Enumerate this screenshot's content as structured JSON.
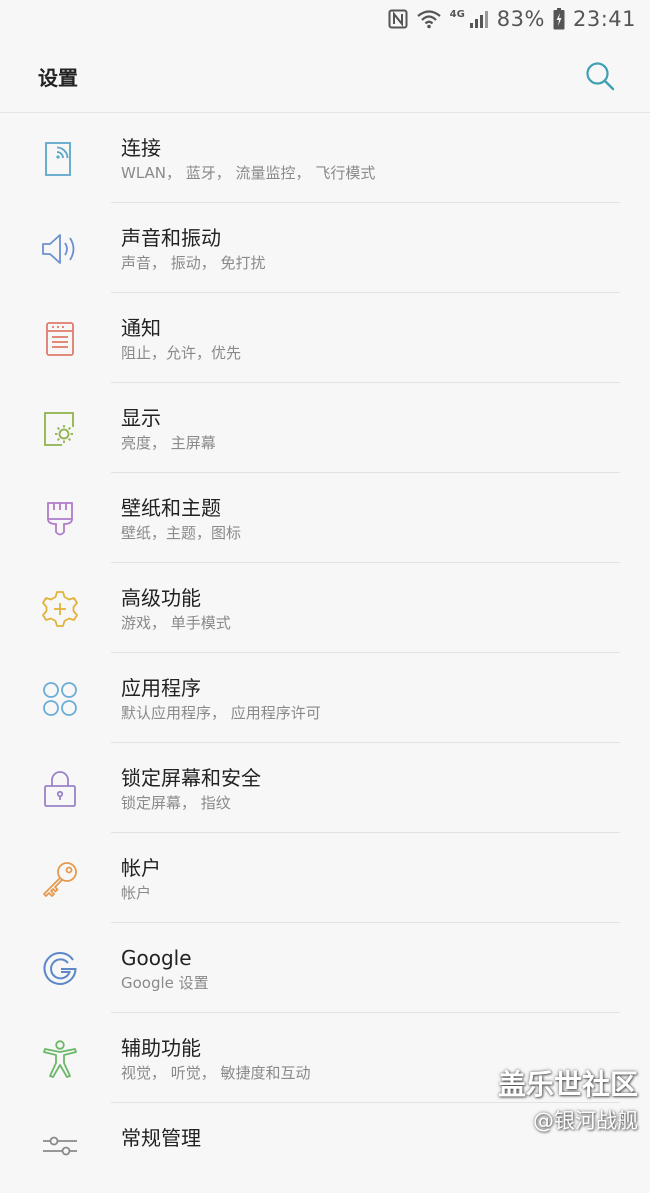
{
  "status_bar": {
    "network_type": "4G",
    "battery": "83%",
    "time": "23:41"
  },
  "header": {
    "title": "设置"
  },
  "items": [
    {
      "label": "连接",
      "sub": "WLAN， 蓝牙， 流量监控， 飞行模式",
      "icon": "connection-icon",
      "color": "#5aa5c9"
    },
    {
      "label": "声音和振动",
      "sub": "声音， 振动， 免打扰",
      "icon": "sound-icon",
      "color": "#6c8fcf"
    },
    {
      "label": "通知",
      "sub": "阻止，允许，优先",
      "icon": "notification-icon",
      "color": "#e07b6b"
    },
    {
      "label": "显示",
      "sub": "亮度， 主屏幕",
      "icon": "display-icon",
      "color": "#8fb24a"
    },
    {
      "label": "壁纸和主题",
      "sub": "壁纸，主题，图标",
      "icon": "brush-icon",
      "color": "#b07bc9"
    },
    {
      "label": "高级功能",
      "sub": "游戏， 单手模式",
      "icon": "advanced-gear-icon",
      "color": "#e2b33c"
    },
    {
      "label": "应用程序",
      "sub": "默认应用程序， 应用程序许可",
      "icon": "apps-icon",
      "color": "#6aaed6"
    },
    {
      "label": "锁定屏幕和安全",
      "sub": "锁定屏幕， 指纹",
      "icon": "lock-icon",
      "color": "#9a82c9"
    },
    {
      "label": "帐户",
      "sub": "帐户",
      "icon": "key-icon",
      "color": "#e49a4f"
    },
    {
      "label": "Google",
      "sub": "Google 设置",
      "icon": "google-icon",
      "color": "#5d87c7"
    },
    {
      "label": "辅助功能",
      "sub": "视觉， 听觉， 敏捷度和互动",
      "icon": "accessibility-icon",
      "color": "#6db86a"
    },
    {
      "label": "常规管理",
      "sub": "",
      "icon": "sliders-icon",
      "color": "#8a8a8a"
    }
  ],
  "watermark": {
    "main": "盖乐世社区",
    "sub": "@银河战舰"
  }
}
